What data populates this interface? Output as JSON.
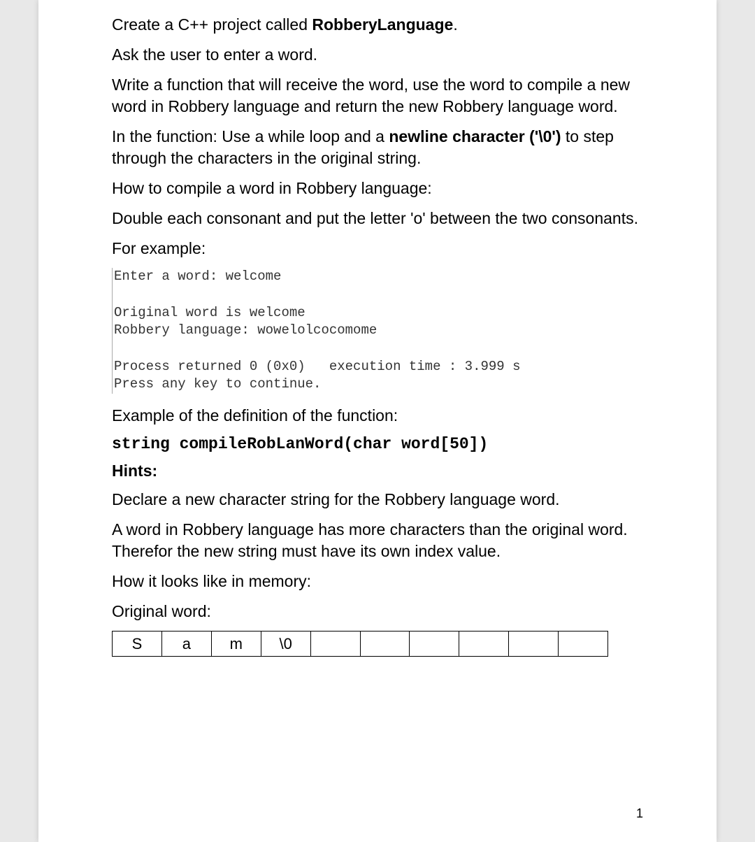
{
  "p1_a": "Create a C++ project called ",
  "p1_b": "RobberyLanguage",
  "p1_c": ".",
  "p2": "Ask the user to enter a word.",
  "p3": "Write a function that will receive the word, use the word to compile a new word in Robbery language and return the new Robbery language word.",
  "p4_a": "In the function: Use a while loop and a ",
  "p4_b": "newline character ('\\0')",
  "p4_c": " to step through the characters in the original string.",
  "p5": "How to compile a word in Robbery language:",
  "p6": "Double each consonant and put the letter 'o' between the two consonants.",
  "p7": "For example:",
  "console": "Enter a word: welcome\n\nOriginal word is welcome\nRobbery language: wowelolcocomome\n\nProcess returned 0 (0x0)   execution time : 3.999 s\nPress any key to continue.",
  "p8": "Example of the definition of the function:",
  "code": "string compileRobLanWord(char word[50])",
  "hints": "Hints:",
  "p9": "Declare a new character string for the Robbery language word.",
  "p10": "A word in Robbery language has more characters than the original word. Therefor the new string must have its own index value.",
  "p11": "How it looks like in memory:",
  "p12": "Original word:",
  "cells": [
    "S",
    "a",
    "m",
    "\\0",
    "",
    "",
    "",
    "",
    "",
    ""
  ],
  "pageNumber": "1"
}
